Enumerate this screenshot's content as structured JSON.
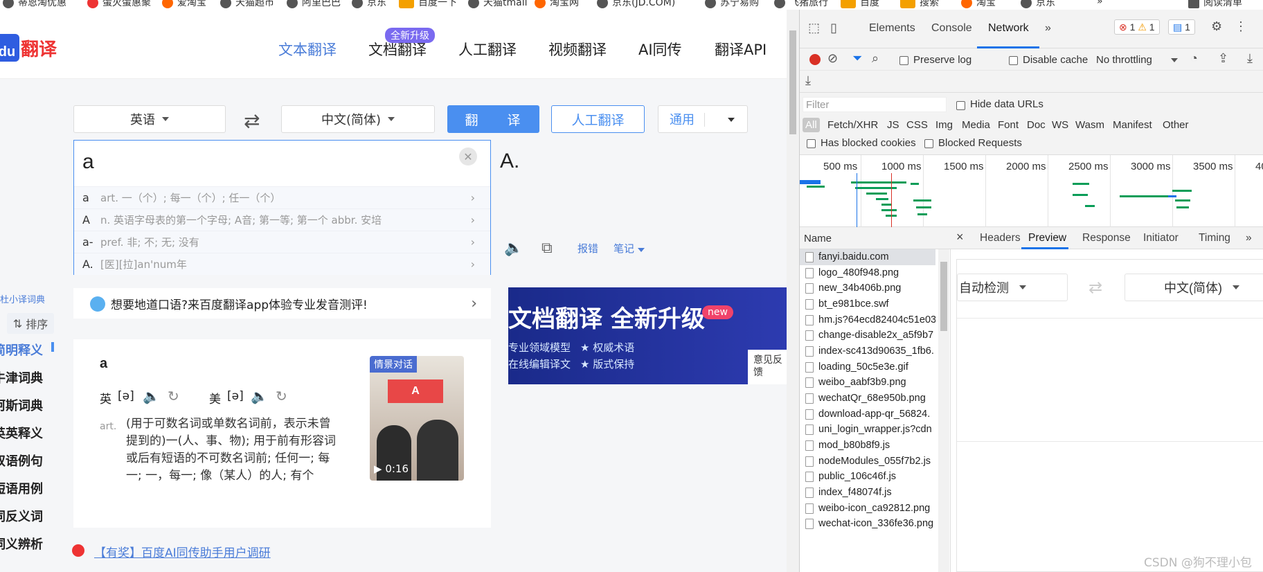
{
  "bookmarks": [
    {
      "label": "蒂恩淘优惠",
      "icon": "globe-icon"
    },
    {
      "label": "蛋灭蛋惠聚",
      "icon": "red-icon"
    },
    {
      "label": "爱淘宝",
      "icon": "taobao-icon"
    },
    {
      "label": "天猫超市",
      "icon": "globe-icon"
    },
    {
      "label": "阿里巴巴",
      "icon": "globe-icon"
    },
    {
      "label": "京东",
      "icon": "globe-icon"
    },
    {
      "label": "百度一下",
      "icon": "hao-icon"
    },
    {
      "label": "天猫tmall",
      "icon": "globe-icon"
    },
    {
      "label": "淘宝网",
      "icon": "taobao-icon"
    },
    {
      "label": "京东(JD.COM)",
      "icon": "globe-icon"
    },
    {
      "label": "苏宁易购",
      "icon": "globe-icon"
    },
    {
      "label": "飞猪旅行",
      "icon": "globe-icon"
    },
    {
      "label": "百度",
      "icon": "hao-icon"
    },
    {
      "label": "搜索",
      "icon": "hao-icon"
    },
    {
      "label": "淘宝",
      "icon": "taobao-icon"
    },
    {
      "label": "京东",
      "icon": "globe-icon"
    },
    {
      "label": "»",
      "icon": ""
    },
    {
      "label": "阅读清单",
      "icon": "reading-list-icon"
    }
  ],
  "page": {
    "logo_text": "翻译",
    "logo_letters": "du",
    "nav": [
      "文本翻译",
      "文档翻译",
      "人工翻译",
      "视频翻译",
      "AI同传",
      "翻译API"
    ],
    "nav_badge": "全新升级",
    "source_lang": "英语",
    "target_lang": "中文(简体)",
    "translate_btn": "翻 译",
    "human_btn": "人工翻译",
    "domain_btn": "通用",
    "input_value": "a",
    "output_value": "A.",
    "suggestions": [
      {
        "word": "a",
        "def": "art. 一（个）; 每一（个）; 任一（个）"
      },
      {
        "word": "A",
        "def": "n. 英语字母表的第一个字母; A音; 第一等; 第一个 abbr. 安培"
      },
      {
        "word": "a-",
        "def": "pref. 非; 不; 无; 没有"
      },
      {
        "word": "A.",
        "def": "[医][拉]an'num年"
      }
    ],
    "report_link": "报错",
    "notes_link": "笔记",
    "app_banner": "想要地道口语?来百度翻译app体验专业发音测评!",
    "ad": {
      "title": "文档翻译 全新升级",
      "badge": "new",
      "features": [
        "专业领域模型",
        "★ 权威术语",
        "在线编辑译文",
        "★ 版式保持"
      ],
      "feedback": "意见反馈"
    },
    "sidebar_head": "杜小译词典",
    "sort_label": "排序",
    "sidebar_items": [
      "简明释义",
      "牛津词典",
      "柯斯词典",
      "英英释义",
      "双语例句",
      "短语用例",
      "同反义词",
      "词义辨析"
    ],
    "dict": {
      "word": "a",
      "uk_label": "英",
      "uk_phon": "[ə]",
      "us_label": "美",
      "us_phon": "[ə]",
      "pos": "art.",
      "definition": "(用于可数名词或单数名词前，表示未曾提到的)一(人、事、物); 用于前有形容词或后有短语的不可数名词前; 任何一; 每一; 一，每一; 像（某人）的人; 有个",
      "video_tag": "情景对话",
      "video_letter": "A",
      "video_duration": "0:16"
    },
    "survey": "【有奖】百度AI同传助手用户调研"
  },
  "devtools": {
    "tabs": [
      "Elements",
      "Console",
      "Network"
    ],
    "more": "»",
    "errors": "1",
    "warnings": "1",
    "messages": "1",
    "preserve_log": "Preserve log",
    "disable_cache": "Disable cache",
    "throttling": "No throttling",
    "filter_placeholder": "Filter",
    "hide_data_urls": "Hide data URLs",
    "types": [
      "All",
      "Fetch/XHR",
      "JS",
      "CSS",
      "Img",
      "Media",
      "Font",
      "Doc",
      "WS",
      "Wasm",
      "Manifest",
      "Other"
    ],
    "has_blocked_cookies": "Has blocked cookies",
    "blocked_requests": "Blocked Requests",
    "timeline_labels": [
      "500 ms",
      "1000 ms",
      "1500 ms",
      "2000 ms",
      "2500 ms",
      "3000 ms",
      "3500 ms",
      "40"
    ],
    "name_header": "Name",
    "requests": [
      "fanyi.baidu.com",
      "logo_480f948.png",
      "new_34b406b.png",
      "bt_e981bce.swf",
      "hm.js?64ecd82404c51e03",
      "change-disable2x_a5f9b7",
      "index-sc413d90635_1fb6.",
      "loading_50c5e3e.gif",
      "weibo_aabf3b9.png",
      "wechatQr_68e950b.png",
      "download-app-qr_56824.",
      "uni_login_wrapper.js?cdn",
      "mod_b80b8f9.js",
      "nodeModules_055f7b2.js",
      "public_106c46f.js",
      "index_f48074f.js",
      "weibo-icon_ca92812.png",
      "wechat-icon_336fe36.png"
    ],
    "detail_tabs": [
      "Headers",
      "Preview",
      "Response",
      "Initiator",
      "Timing"
    ],
    "preview": {
      "source": "自动检测",
      "target": "中文(简体)"
    }
  },
  "watermark": "CSDN @狗不理小包"
}
